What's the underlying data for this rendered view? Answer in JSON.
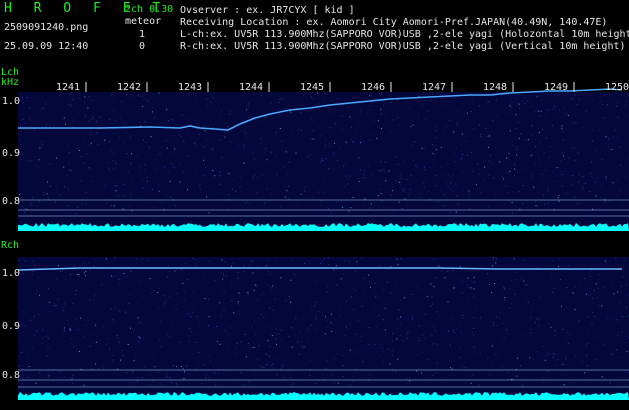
{
  "header": {
    "brand": "H R O F F T",
    "version": "2ch 0.30",
    "filename": "2509091240.png",
    "meteor_label": "meteor",
    "datetime": "25.09.09 12:40",
    "l_count": "1",
    "r_count": "0",
    "observer": "Ovserver           : ex. JR7CYX [ kid ]",
    "location": "Receiving Location : ex. Aomori City Aomori-Pref.JAPAN(40.49N, 140.47E)",
    "lch_info": "L-ch:ex. UV5R 113.900Mhz(SAPPORO VOR)USB ,2-ele yagi (Holozontal 10m height",
    "rch_info": "R-ch:ex. UV5R 113.900Mhz(SAPPORO VOR)USB ,2-ele yagi (Vertical 10m height)"
  },
  "time_ticks": [
    "1241",
    "1242",
    "1243",
    "1244",
    "1245",
    "1246",
    "1247",
    "1248",
    "1249",
    "1250"
  ],
  "lch": {
    "label": "Lch",
    "unit": "kHz",
    "freq_ticks": [
      "1.0",
      "0.9",
      "0.8"
    ]
  },
  "rch": {
    "label": "Rch",
    "freq_ticks": [
      "1.0",
      "0.9",
      "0.8"
    ]
  },
  "colors": {
    "background": "#000000",
    "spectrogram": "#03073c",
    "signal": "#4aa8ff",
    "noise_floor": "#00ffff",
    "label_green": "#22ee22",
    "label_white": "#e6e6e6"
  }
}
